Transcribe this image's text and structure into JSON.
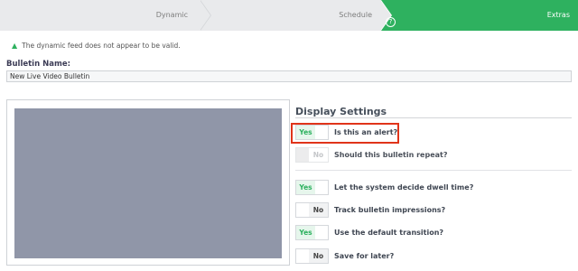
{
  "steps": [
    {
      "label": "Dynamic"
    },
    {
      "label": "Schedule"
    },
    {
      "label": "Extras"
    }
  ],
  "help_icon": {
    "glyph": "?",
    "icon": "help-circle-icon"
  },
  "warning": {
    "icon": "warning-triangle-icon",
    "glyph": "▲",
    "text": "The dynamic feed does not appear to be valid."
  },
  "bulletin": {
    "label": "Bulletin Name:",
    "value": "New Live Video Bulletin"
  },
  "display_settings": {
    "title": "Display Settings",
    "yes_label": "Yes",
    "no_label": "No",
    "items": [
      {
        "label": "Is this an alert?",
        "value": "Yes",
        "disabled": false
      },
      {
        "label": "Should this bulletin repeat?",
        "value": "No",
        "disabled": true
      },
      {
        "label": "Let the system decide dwell time?",
        "value": "Yes",
        "disabled": false
      },
      {
        "label": "Track bulletin impressions?",
        "value": "No",
        "disabled": false
      },
      {
        "label": "Use the default transition?",
        "value": "Yes",
        "disabled": false
      },
      {
        "label": "Save for later?",
        "value": "No",
        "disabled": false
      }
    ]
  },
  "colors": {
    "accent": "#2eb15f",
    "highlight": "#e0341a",
    "preview": "#9096a8"
  }
}
